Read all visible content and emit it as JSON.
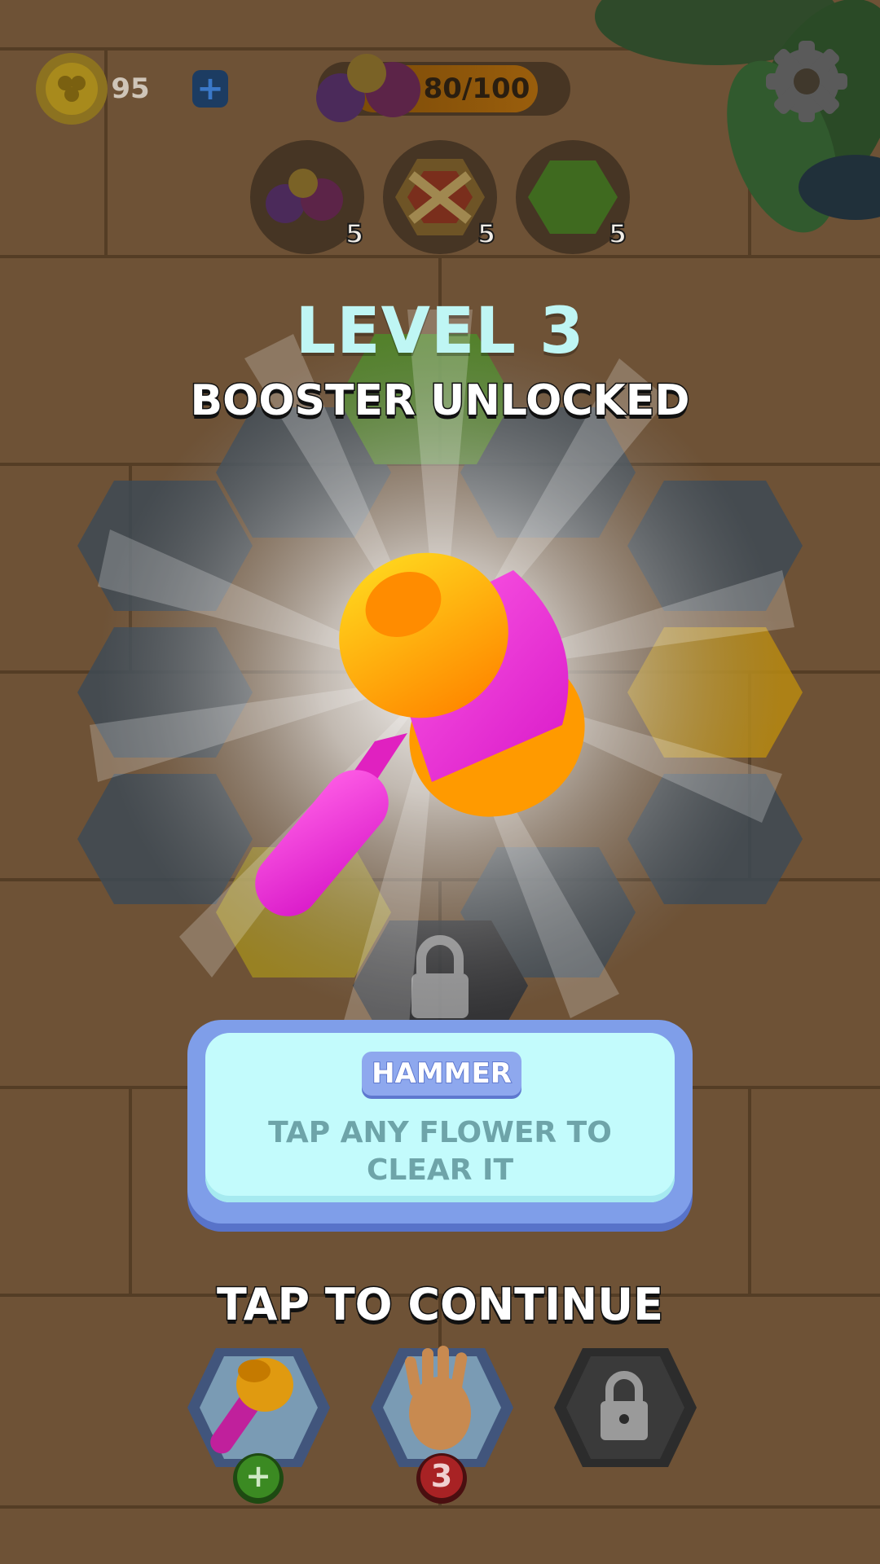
{
  "hud": {
    "coins": "95",
    "flower_progress": "80/100",
    "settings_icon": "gear-icon"
  },
  "goals": [
    {
      "icon": "flower-cluster-icon",
      "count": "5"
    },
    {
      "icon": "crossed-hex-tile-icon",
      "count": "5"
    },
    {
      "icon": "green-hex-tile-icon",
      "count": "5"
    }
  ],
  "popup": {
    "level_title": "LEVEL 3",
    "subtitle": "BOOSTER UNLOCKED",
    "booster_icon": "hammer-icon",
    "booster_name": "HAMMER",
    "description": "TAP ANY FLOWER TO CLEAR IT",
    "continue_label": "TAP TO CONTINUE"
  },
  "boosters": [
    {
      "icon": "hammer-icon",
      "badge": "+",
      "badge_color": "#3fa02a"
    },
    {
      "icon": "hand-icon",
      "badge": "3",
      "badge_color": "#c0282a"
    },
    {
      "icon": "lock-icon",
      "locked": true
    }
  ],
  "colors": {
    "level_title": "#bff6f4",
    "card_border": "#7f9ee9",
    "card_fill": "#c3fbfc",
    "hammer_head": "#ffb319",
    "hammer_band": "#f23fd6"
  }
}
